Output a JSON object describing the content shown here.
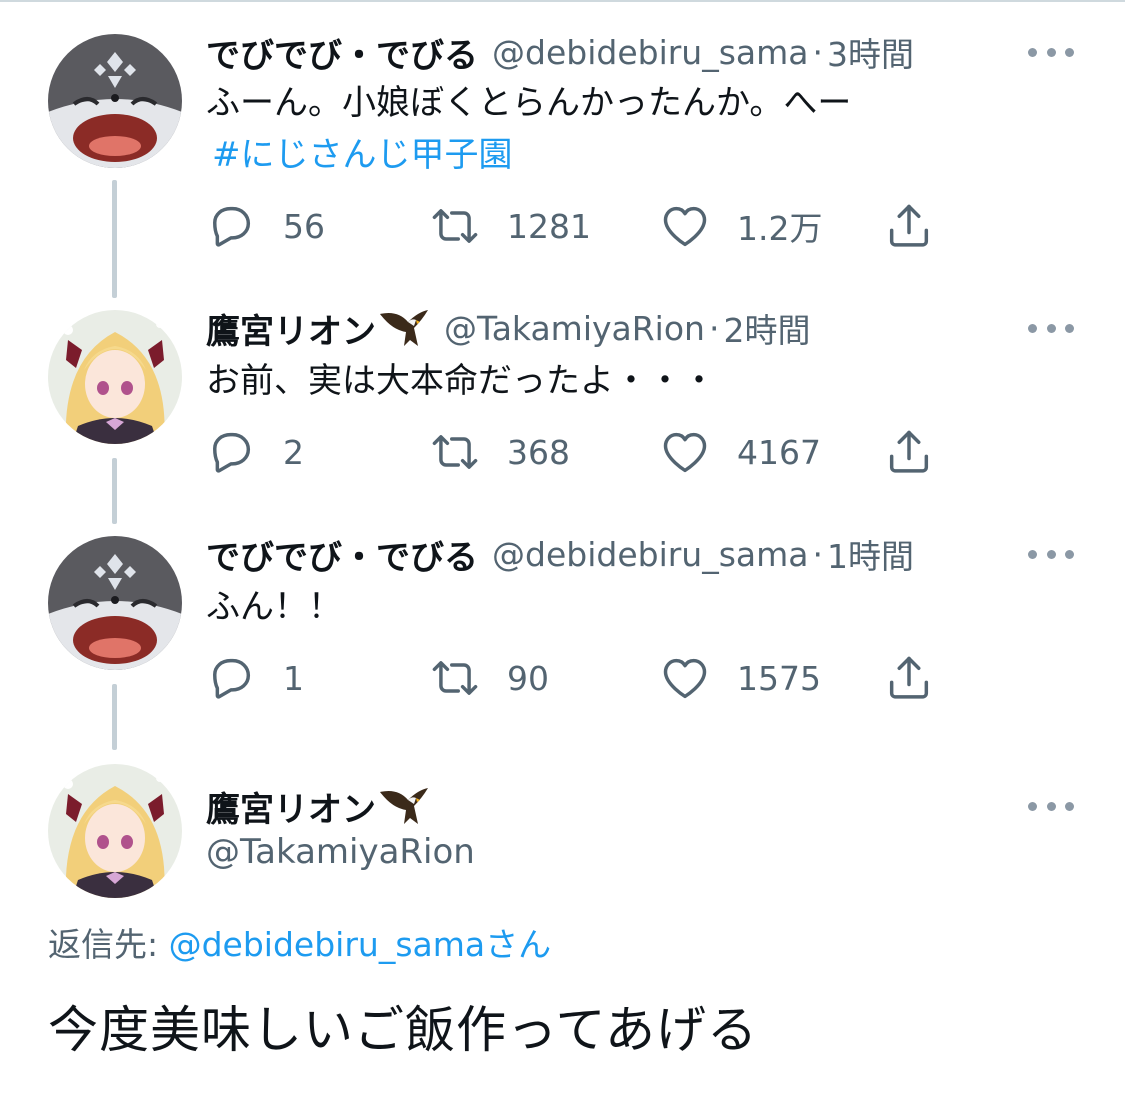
{
  "tweets": [
    {
      "name": "でびでび・でびる",
      "handle": "@debidebiru_sama",
      "time": "3時間",
      "text": "ふーん。小娘ぼくとらんかったんか。へー",
      "hashtag": "#にじさんじ甲子園",
      "replies": "56",
      "retweets": "1281",
      "likes": "1.2万"
    },
    {
      "name": "鷹宮リオン",
      "handle": "@TakamiyaRion",
      "time": "2時間",
      "text": "お前、実は大本命だったよ・・・",
      "replies": "2",
      "retweets": "368",
      "likes": "4167"
    },
    {
      "name": "でびでび・でびる",
      "handle": "@debidebiru_sama",
      "time": "1時間",
      "text": "ふん！！",
      "replies": "1",
      "retweets": "90",
      "likes": "1575"
    }
  ],
  "focused": {
    "name": "鷹宮リオン",
    "handle": "@TakamiyaRion",
    "reply_label": "返信先: ",
    "reply_mention": "@debidebiru_sama",
    "reply_suffix": "さん",
    "text": "今度美味しいご飯作ってあげる"
  },
  "icons": {
    "reply": "reply-icon",
    "retweet": "retweet-icon",
    "like": "heart-icon",
    "share": "share-icon",
    "more": "more-icon",
    "emoji": "eagle-emoji"
  },
  "colors": {
    "link": "#1d9bf0",
    "secondary": "#536471",
    "thread": "#c4cfd6"
  }
}
